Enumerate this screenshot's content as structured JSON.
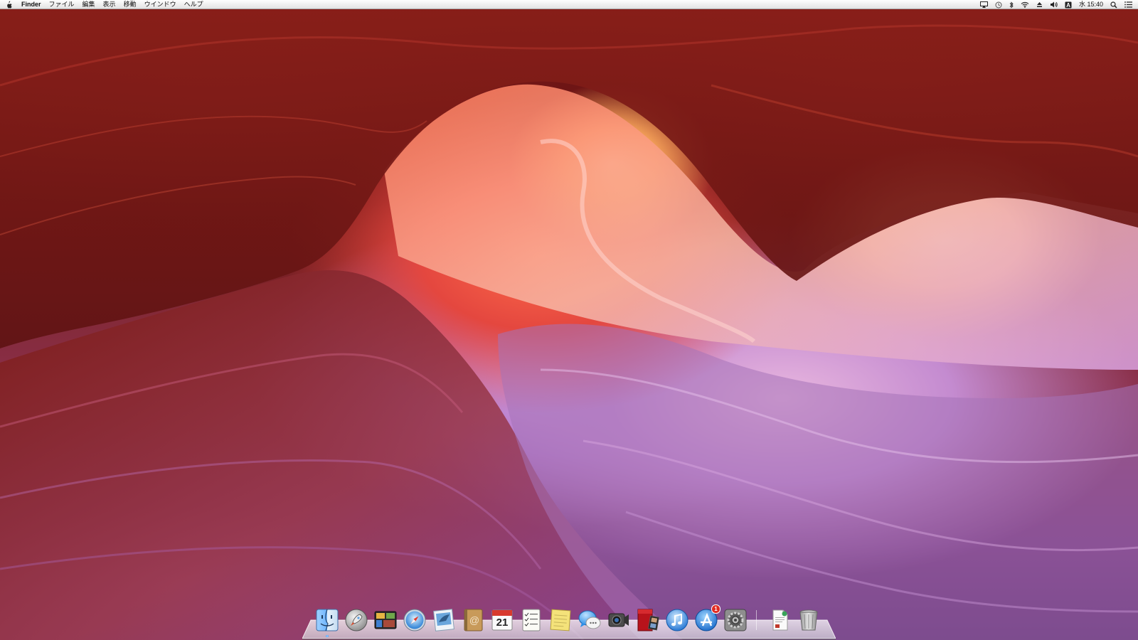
{
  "menubar": {
    "app_name": "Finder",
    "menus": [
      "ファイル",
      "編集",
      "表示",
      "移動",
      "ウインドウ",
      "ヘルプ"
    ],
    "clock": "水 15:40",
    "input_source": "A",
    "status_icons": [
      "airplay-icon",
      "time-machine-icon",
      "bluetooth-icon",
      "wifi-icon",
      "eject-icon",
      "volume-icon",
      "input-source-icon",
      "spotlight-icon",
      "notification-center-icon"
    ]
  },
  "dock": {
    "apps": [
      {
        "name": "finder",
        "icon": "finder-icon",
        "running": true
      },
      {
        "name": "launchpad",
        "icon": "launchpad-icon"
      },
      {
        "name": "mission-control",
        "icon": "mission-control-icon"
      },
      {
        "name": "safari",
        "icon": "safari-icon"
      },
      {
        "name": "mail",
        "icon": "mail-icon"
      },
      {
        "name": "contacts",
        "icon": "contacts-icon"
      },
      {
        "name": "calendar",
        "icon": "calendar-icon",
        "date": "21"
      },
      {
        "name": "reminders",
        "icon": "reminders-icon"
      },
      {
        "name": "notes",
        "icon": "notes-icon"
      },
      {
        "name": "messages",
        "icon": "messages-icon"
      },
      {
        "name": "facetime",
        "icon": "facetime-icon"
      },
      {
        "name": "photo-booth",
        "icon": "photo-booth-icon"
      },
      {
        "name": "itunes",
        "icon": "itunes-icon"
      },
      {
        "name": "app-store",
        "icon": "app-store-icon",
        "badge": "1"
      },
      {
        "name": "system-preferences",
        "icon": "system-preferences-icon"
      }
    ],
    "documents": [
      {
        "name": "document",
        "icon": "document-icon"
      },
      {
        "name": "trash",
        "icon": "trash-icon"
      }
    ]
  },
  "colors": {
    "menubar_bg": "#ececec",
    "badge_red": "#e12b22",
    "running_indicator": "#4aa3ff"
  }
}
